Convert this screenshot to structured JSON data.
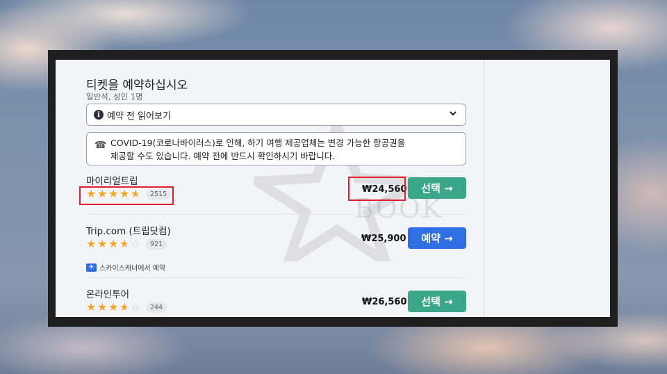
{
  "header": {
    "title": "티켓을 예약하십시오",
    "subtitle": "일반석, 성인 1명"
  },
  "read_before": {
    "icon": "info-icon",
    "label": "예약 전 읽어보기",
    "chevron": "chevron-down-icon"
  },
  "notice": {
    "icon": "phone-icon",
    "text_line1": "COVID-19(코로나바이러스)로 인해, 하기 여행 제공업체는 변경 가능한 항공권을",
    "text_line2": "제공할 수도 있습니다. 예약 전에 반드시 확인하시기 바랍니다."
  },
  "providers": [
    {
      "name": "마이리얼트립",
      "rating": 4.5,
      "review_count": "2515",
      "price": "₩24,560",
      "button": "선택 →",
      "button_color": "#3aa68a"
    },
    {
      "name": "Trip.com (트립닷컴)",
      "rating": 3.5,
      "review_count": "921",
      "price": "₩25,900",
      "button": "예약 →",
      "button_color": "#2f6fe4",
      "note": "스카이스캐너에서 예약"
    },
    {
      "name": "온라인투어",
      "rating": 3.5,
      "review_count": "244",
      "price": "₩26,560",
      "button": "선택 →",
      "button_color": "#3aa68a"
    }
  ],
  "watermark": "BOOK",
  "colors": {
    "star": "#f5a623",
    "highlight": "#e0202a"
  }
}
